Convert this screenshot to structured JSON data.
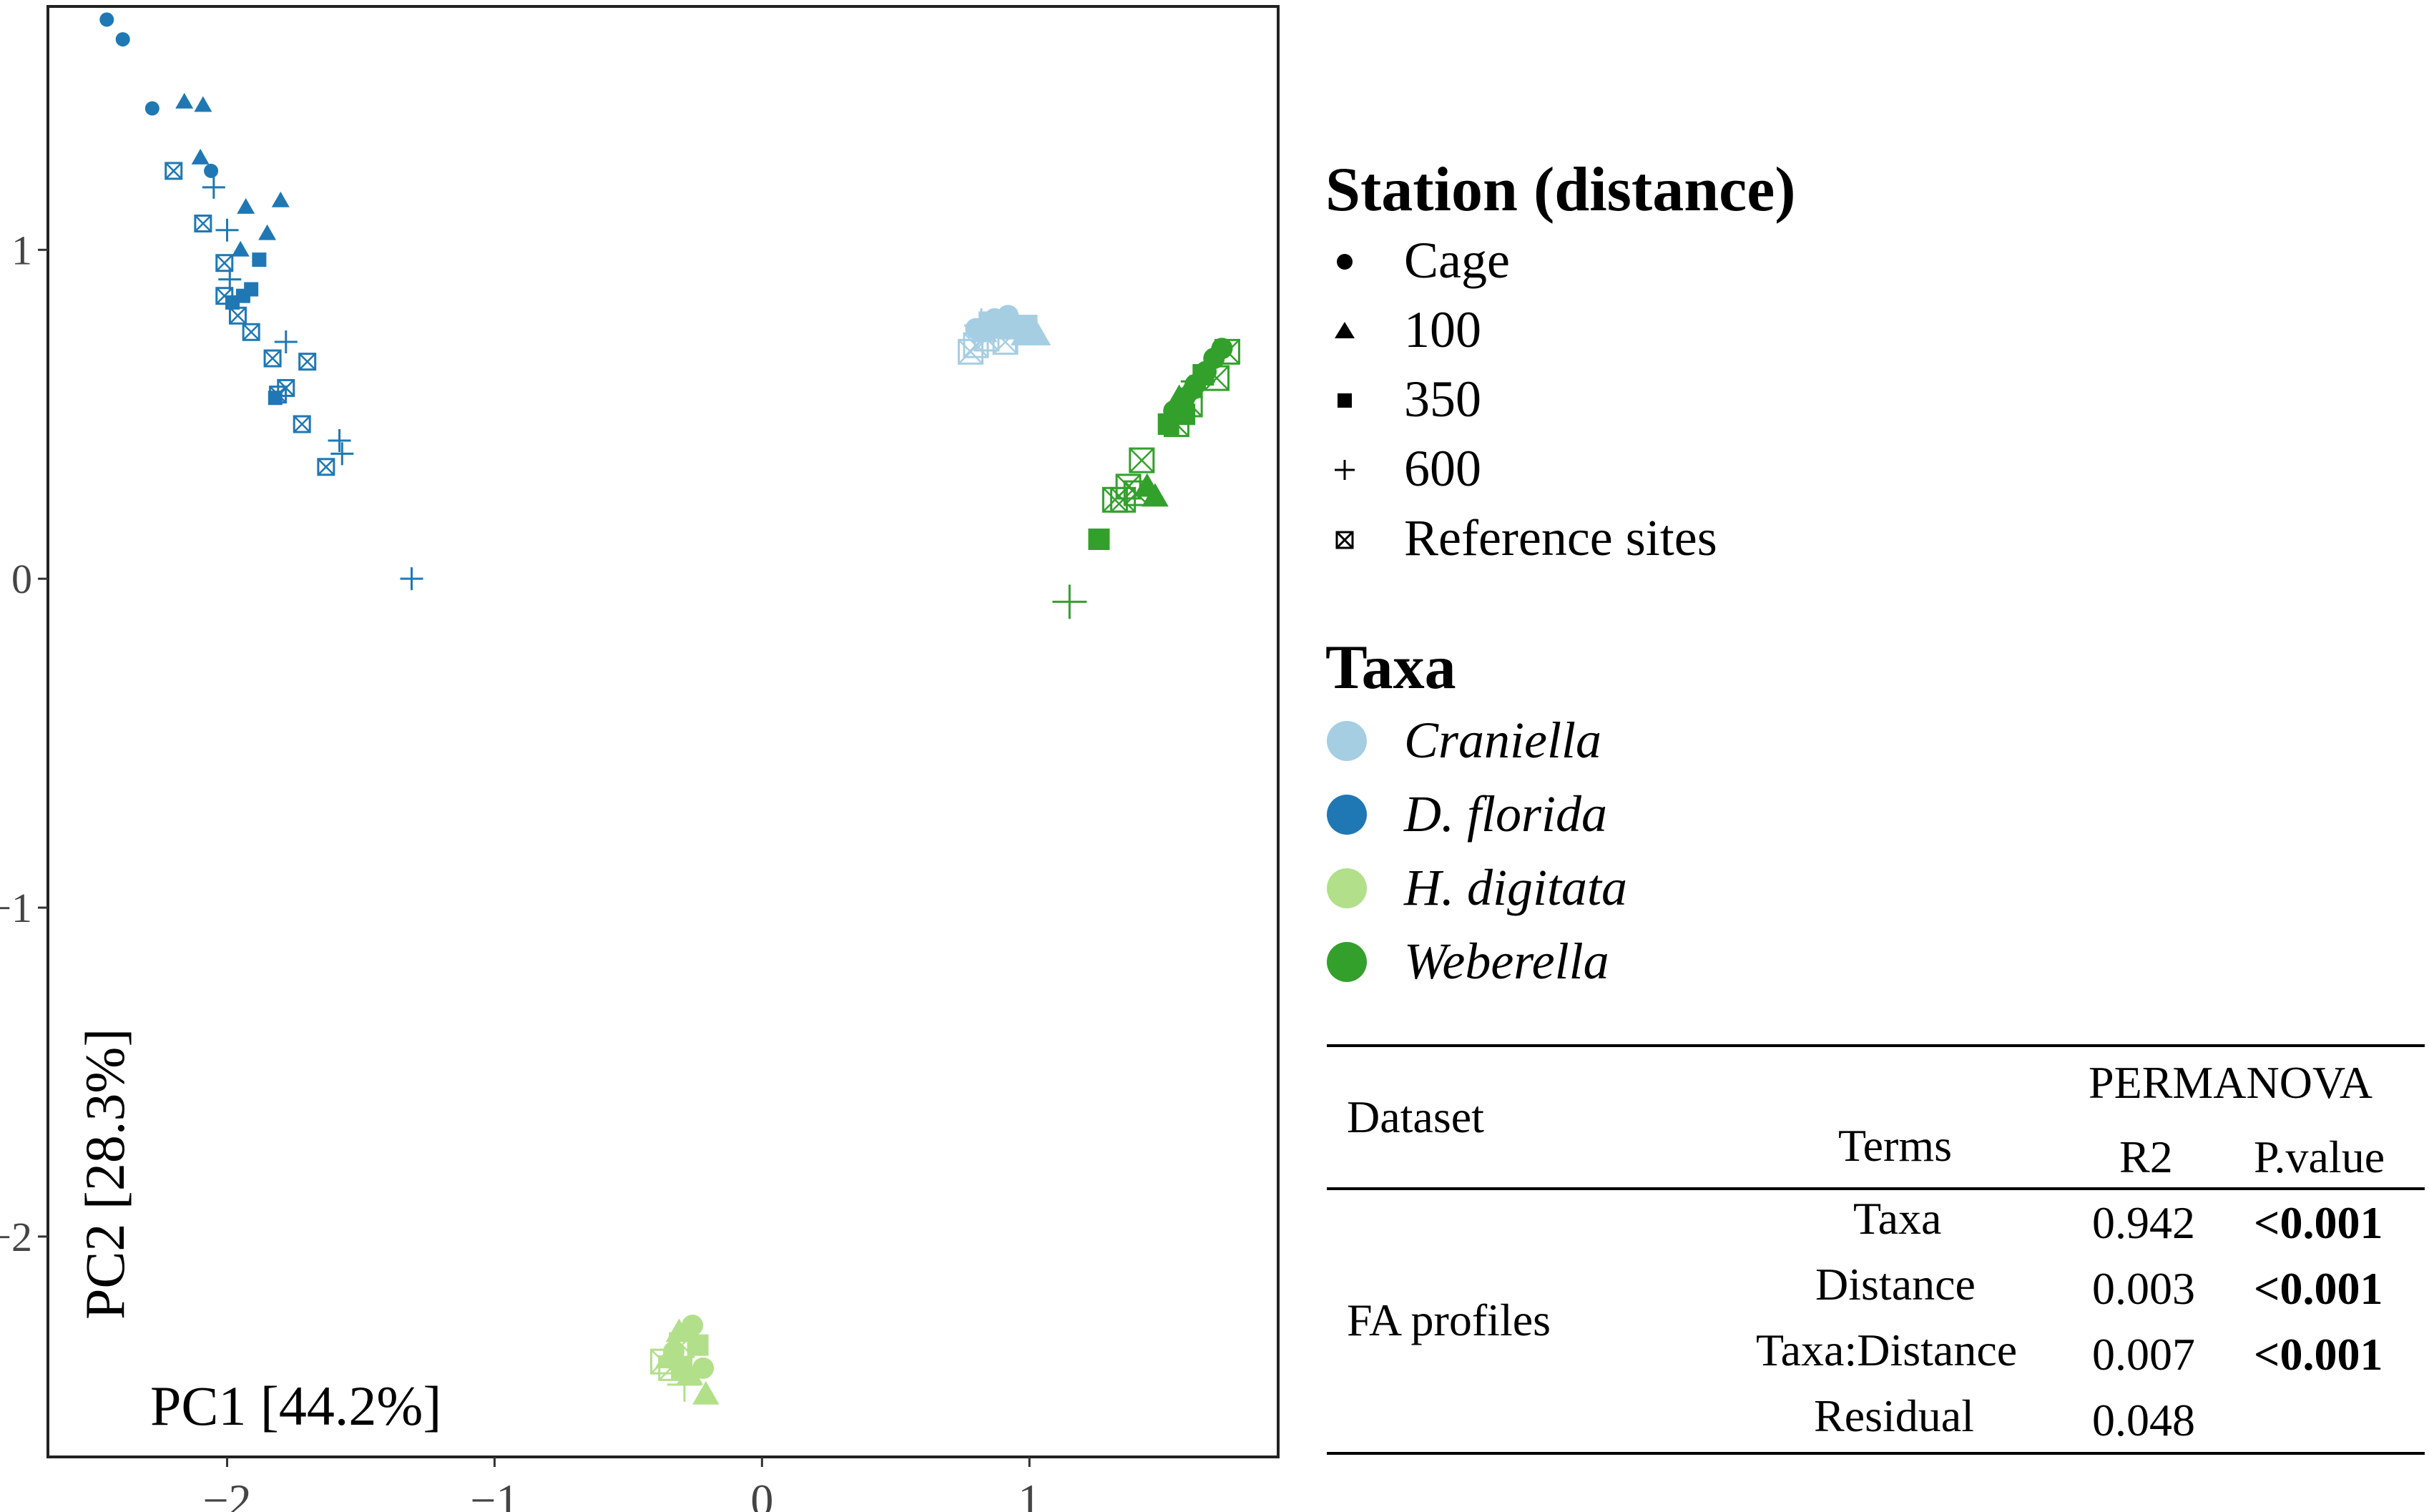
{
  "chart_data": {
    "type": "scatter",
    "xlabel": "PC1 [44.2%]",
    "ylabel": "PC2 [28.3%]",
    "xlim": [
      -2.67,
      1.93
    ],
    "ylim": [
      -2.67,
      1.74
    ],
    "x_ticks": [
      -2,
      -1,
      0,
      1
    ],
    "x_tick_labels": [
      "−2",
      "−1",
      "0",
      "1"
    ],
    "y_ticks": [
      -2,
      -1,
      0,
      1
    ],
    "y_tick_labels": [
      "−2",
      "−1",
      "0",
      "1"
    ],
    "grid": false,
    "legend_position": "right",
    "station_legend": {
      "title": "Station (distance)",
      "items": [
        {
          "label": "Cage",
          "shape": "circle"
        },
        {
          "label": "100",
          "shape": "triangle"
        },
        {
          "label": "350",
          "shape": "square"
        },
        {
          "label": "600",
          "shape": "plus"
        },
        {
          "label": "Reference sites",
          "shape": "boxx"
        }
      ]
    },
    "taxa_legend": {
      "title": "Taxa",
      "items": [
        {
          "label": "Craniella",
          "color": "#a6cee3"
        },
        {
          "label": "D. florida",
          "color": "#1f78b4"
        },
        {
          "label": "H. digitata",
          "color": "#b2df8a"
        },
        {
          "label": "Weberella",
          "color": "#33a02c"
        }
      ]
    },
    "series": [
      {
        "name": "D. florida",
        "color": "#1f78b4",
        "points": [
          {
            "x": -2.45,
            "y": 1.7,
            "shape": "circle"
          },
          {
            "x": -2.39,
            "y": 1.64,
            "shape": "circle"
          },
          {
            "x": -2.28,
            "y": 1.43,
            "shape": "circle"
          },
          {
            "x": -2.06,
            "y": 1.24,
            "shape": "circle"
          },
          {
            "x": -2.16,
            "y": 1.45,
            "shape": "triangle"
          },
          {
            "x": -2.09,
            "y": 1.44,
            "shape": "triangle"
          },
          {
            "x": -2.1,
            "y": 1.28,
            "shape": "triangle"
          },
          {
            "x": -1.93,
            "y": 1.13,
            "shape": "triangle"
          },
          {
            "x": -1.8,
            "y": 1.15,
            "shape": "triangle"
          },
          {
            "x": -1.85,
            "y": 1.05,
            "shape": "triangle"
          },
          {
            "x": -1.95,
            "y": 1.0,
            "shape": "triangle"
          },
          {
            "x": -1.88,
            "y": 0.97,
            "shape": "square"
          },
          {
            "x": -1.91,
            "y": 0.88,
            "shape": "square"
          },
          {
            "x": -1.94,
            "y": 0.86,
            "shape": "square"
          },
          {
            "x": -1.98,
            "y": 0.84,
            "shape": "square"
          },
          {
            "x": -1.82,
            "y": 0.55,
            "shape": "square"
          },
          {
            "x": -2.05,
            "y": 1.19,
            "shape": "plus"
          },
          {
            "x": -2.0,
            "y": 1.06,
            "shape": "plus"
          },
          {
            "x": -1.99,
            "y": 0.91,
            "shape": "plus"
          },
          {
            "x": -1.78,
            "y": 0.72,
            "shape": "plus"
          },
          {
            "x": -1.58,
            "y": 0.42,
            "shape": "plus"
          },
          {
            "x": -1.57,
            "y": 0.38,
            "shape": "plus"
          },
          {
            "x": -1.31,
            "y": 0.0,
            "shape": "plus"
          },
          {
            "x": -2.2,
            "y": 1.24,
            "shape": "boxx"
          },
          {
            "x": -2.09,
            "y": 1.08,
            "shape": "boxx"
          },
          {
            "x": -2.01,
            "y": 0.96,
            "shape": "boxx"
          },
          {
            "x": -2.01,
            "y": 0.86,
            "shape": "boxx"
          },
          {
            "x": -1.96,
            "y": 0.8,
            "shape": "boxx"
          },
          {
            "x": -1.91,
            "y": 0.75,
            "shape": "boxx"
          },
          {
            "x": -1.83,
            "y": 0.67,
            "shape": "boxx"
          },
          {
            "x": -1.7,
            "y": 0.66,
            "shape": "boxx"
          },
          {
            "x": -1.78,
            "y": 0.58,
            "shape": "boxx"
          },
          {
            "x": -1.81,
            "y": 0.56,
            "shape": "boxx"
          },
          {
            "x": -1.72,
            "y": 0.47,
            "shape": "boxx"
          },
          {
            "x": -1.63,
            "y": 0.34,
            "shape": "boxx"
          }
        ]
      },
      {
        "name": "Craniella",
        "color": "#a6cee3",
        "points": [
          {
            "x": 0.8,
            "y": 0.76,
            "shape": "circle"
          },
          {
            "x": 0.87,
            "y": 0.79,
            "shape": "circle"
          },
          {
            "x": 0.92,
            "y": 0.8,
            "shape": "circle"
          },
          {
            "x": 0.96,
            "y": 0.77,
            "shape": "circle"
          },
          {
            "x": 0.83,
            "y": 0.75,
            "shape": "triangle"
          },
          {
            "x": 0.9,
            "y": 0.76,
            "shape": "triangle"
          },
          {
            "x": 0.98,
            "y": 0.74,
            "shape": "triangle"
          },
          {
            "x": 1.03,
            "y": 0.74,
            "shape": "triangle"
          },
          {
            "x": 0.85,
            "y": 0.78,
            "shape": "square"
          },
          {
            "x": 0.93,
            "y": 0.76,
            "shape": "square"
          },
          {
            "x": 0.99,
            "y": 0.77,
            "shape": "square"
          },
          {
            "x": 0.82,
            "y": 0.77,
            "shape": "plus"
          },
          {
            "x": 0.95,
            "y": 0.74,
            "shape": "plus"
          },
          {
            "x": 0.8,
            "y": 0.71,
            "shape": "boxx"
          },
          {
            "x": 0.84,
            "y": 0.73,
            "shape": "boxx"
          },
          {
            "x": 0.78,
            "y": 0.69,
            "shape": "boxx"
          },
          {
            "x": 0.91,
            "y": 0.72,
            "shape": "boxx"
          }
        ]
      },
      {
        "name": "Weberella",
        "color": "#33a02c",
        "points": [
          {
            "x": 1.72,
            "y": 0.7,
            "shape": "circle"
          },
          {
            "x": 1.69,
            "y": 0.67,
            "shape": "circle"
          },
          {
            "x": 1.66,
            "y": 0.63,
            "shape": "circle"
          },
          {
            "x": 1.62,
            "y": 0.59,
            "shape": "circle"
          },
          {
            "x": 1.58,
            "y": 0.55,
            "shape": "circle"
          },
          {
            "x": 1.54,
            "y": 0.51,
            "shape": "circle"
          },
          {
            "x": 1.56,
            "y": 0.55,
            "shape": "triangle"
          },
          {
            "x": 1.47,
            "y": 0.25,
            "shape": "triangle"
          },
          {
            "x": 1.44,
            "y": 0.28,
            "shape": "triangle"
          },
          {
            "x": 1.6,
            "y": 0.58,
            "shape": "triangle"
          },
          {
            "x": 1.26,
            "y": 0.12,
            "shape": "square"
          },
          {
            "x": 1.65,
            "y": 0.62,
            "shape": "square"
          },
          {
            "x": 1.58,
            "y": 0.5,
            "shape": "square"
          },
          {
            "x": 1.52,
            "y": 0.47,
            "shape": "square"
          },
          {
            "x": 1.15,
            "y": -0.07,
            "shape": "plus"
          },
          {
            "x": 1.63,
            "y": 0.6,
            "shape": "plus"
          },
          {
            "x": 1.74,
            "y": 0.69,
            "shape": "boxx"
          },
          {
            "x": 1.7,
            "y": 0.61,
            "shape": "boxx"
          },
          {
            "x": 1.6,
            "y": 0.53,
            "shape": "boxx"
          },
          {
            "x": 1.55,
            "y": 0.47,
            "shape": "boxx"
          },
          {
            "x": 1.42,
            "y": 0.36,
            "shape": "boxx"
          },
          {
            "x": 1.37,
            "y": 0.28,
            "shape": "boxx"
          },
          {
            "x": 1.35,
            "y": 0.24,
            "shape": "boxx"
          },
          {
            "x": 1.4,
            "y": 0.26,
            "shape": "boxx"
          },
          {
            "x": 1.32,
            "y": 0.24,
            "shape": "boxx"
          }
        ]
      },
      {
        "name": "H. digitata",
        "color": "#b2df8a",
        "points": [
          {
            "x": -0.26,
            "y": -2.27,
            "shape": "circle"
          },
          {
            "x": -0.33,
            "y": -2.35,
            "shape": "circle"
          },
          {
            "x": -0.22,
            "y": -2.4,
            "shape": "circle"
          },
          {
            "x": -0.31,
            "y": -2.29,
            "shape": "triangle"
          },
          {
            "x": -0.27,
            "y": -2.42,
            "shape": "triangle"
          },
          {
            "x": -0.21,
            "y": -2.48,
            "shape": "triangle"
          },
          {
            "x": -0.35,
            "y": -2.37,
            "shape": "triangle"
          },
          {
            "x": -0.3,
            "y": -2.4,
            "shape": "square"
          },
          {
            "x": -0.24,
            "y": -2.33,
            "shape": "square"
          },
          {
            "x": -0.29,
            "y": -2.45,
            "shape": "plus"
          },
          {
            "x": -0.34,
            "y": -2.4,
            "shape": "boxx"
          },
          {
            "x": -0.3,
            "y": -2.33,
            "shape": "boxx"
          },
          {
            "x": -0.37,
            "y": -2.38,
            "shape": "boxx"
          }
        ]
      }
    ]
  },
  "stats_table": {
    "headers": {
      "dataset": "Dataset",
      "terms": "Terms",
      "permanova": "PERMANOVA",
      "r2": "R2",
      "pvalue": "P.value"
    },
    "dataset_label": "FA profiles",
    "rows": [
      {
        "term": "Taxa",
        "r2": "0.942",
        "p": "<0.001"
      },
      {
        "term": "Distance",
        "r2": "0.003",
        "p": "<0.001"
      },
      {
        "term": "Taxa:Distance",
        "r2": "0.007",
        "p": "<0.001"
      },
      {
        "term": "Residual",
        "r2": "0.048",
        "p": ""
      }
    ]
  }
}
